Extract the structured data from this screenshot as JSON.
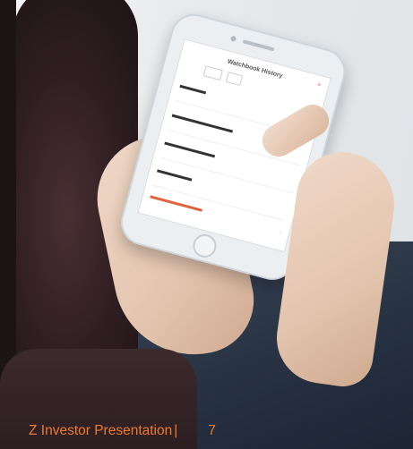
{
  "caption": {
    "title": "Z Investor Presentation",
    "separator": "|",
    "page_number": "7"
  },
  "phone_screen": {
    "title": "Watchbook History",
    "close": "×",
    "chevron": "›"
  },
  "colors": {
    "caption": "#f07a2c",
    "accent_orange": "#e0623e",
    "accent_blue": "#2f9bd8"
  }
}
